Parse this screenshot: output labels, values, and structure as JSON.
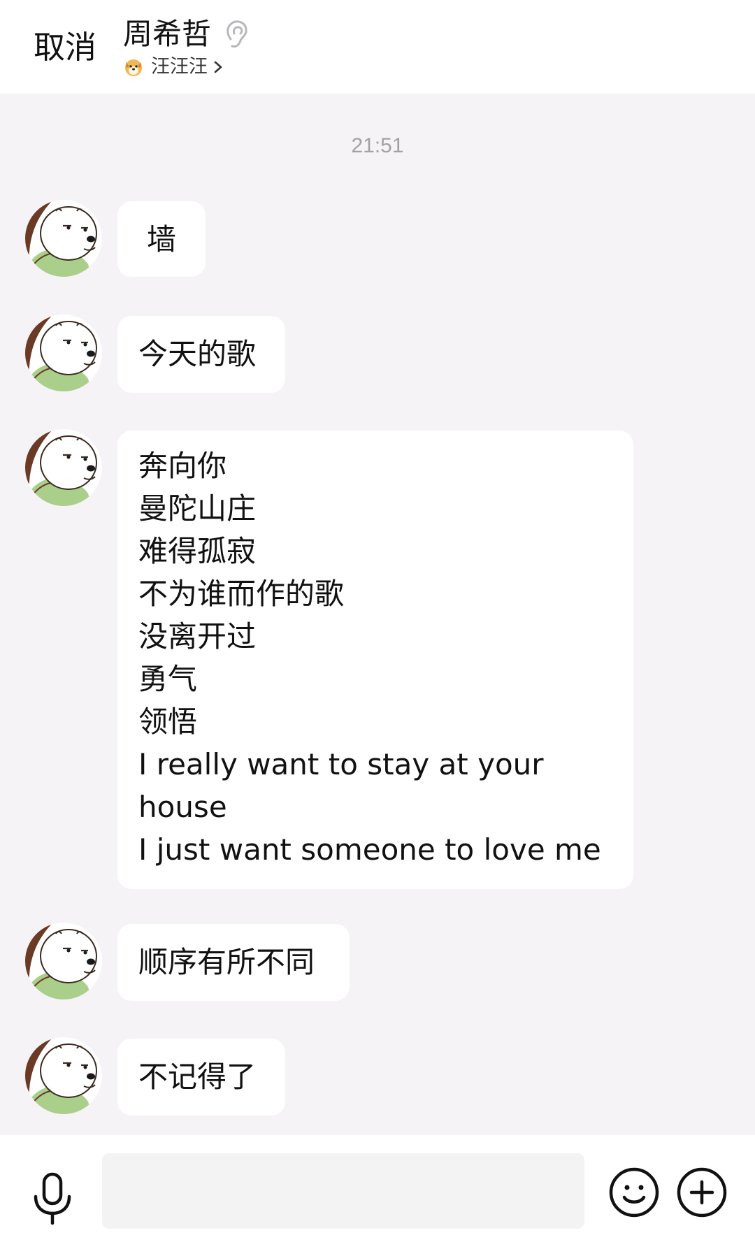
{
  "header": {
    "cancel_label": "取消",
    "contact_name": "周希哲",
    "status_text": "汪汪汪",
    "status_icon": "dog-emoji-icon",
    "ear_icon": "earpiece-mode-icon"
  },
  "chat": {
    "timestamp": "21:51",
    "messages": [
      {
        "lines": [
          "墙"
        ]
      },
      {
        "lines": [
          "今天的歌"
        ]
      },
      {
        "lines": [
          "奔向你",
          "曼陀山庄",
          "难得孤寂",
          "不为谁而作的歌",
          "没离开过",
          "勇气",
          "领悟",
          "I really want to stay at your",
          "house",
          "I just want someone to love me"
        ]
      },
      {
        "lines": [
          "顺序有所不同"
        ]
      },
      {
        "lines": [
          "不记得了"
        ]
      }
    ]
  },
  "input_bar": {
    "placeholder": "",
    "voice_icon": "microphone-icon",
    "emoji_icon": "smiley-icon",
    "plus_icon": "plus-circle-icon"
  },
  "colors": {
    "header_bg": "#ffffff",
    "chat_bg": "#f5f3f6",
    "bubble_bg": "#ffffff",
    "timestamp": "#a3a1a6",
    "avatar_outline": "#6b3a24",
    "avatar_shirt": "#a9cf8a"
  }
}
